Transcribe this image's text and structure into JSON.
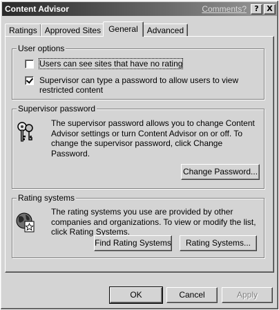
{
  "window": {
    "title": "Content Advisor",
    "comments_link": "Comments?",
    "help_button": "?",
    "close_button": "X"
  },
  "tabs": [
    {
      "label": "Ratings",
      "active": false
    },
    {
      "label": "Approved Sites",
      "active": false
    },
    {
      "label": "General",
      "active": true
    },
    {
      "label": "Advanced",
      "active": false
    }
  ],
  "user_options": {
    "legend": "User options",
    "options": [
      {
        "label": "Users can see sites that have no rating",
        "checked": false
      },
      {
        "label": "Supervisor can type a password to allow users to view restricted content",
        "checked": true
      }
    ]
  },
  "supervisor_password": {
    "legend": "Supervisor password",
    "description": "The supervisor password allows you to change Content Advisor settings or turn Content Advisor on or off. To change the supervisor password, click Change Password.",
    "change_button": "Change Password...",
    "icon": "keys-icon"
  },
  "rating_systems": {
    "legend": "Rating systems",
    "description": "The rating systems you use are provided by other companies and organizations. To view or modify the list, click Rating Systems.",
    "find_button": "Find Rating Systems",
    "systems_button": "Rating Systems...",
    "icon": "globe-certificate-icon"
  },
  "footer": {
    "ok": "OK",
    "cancel": "Cancel",
    "apply": "Apply"
  }
}
